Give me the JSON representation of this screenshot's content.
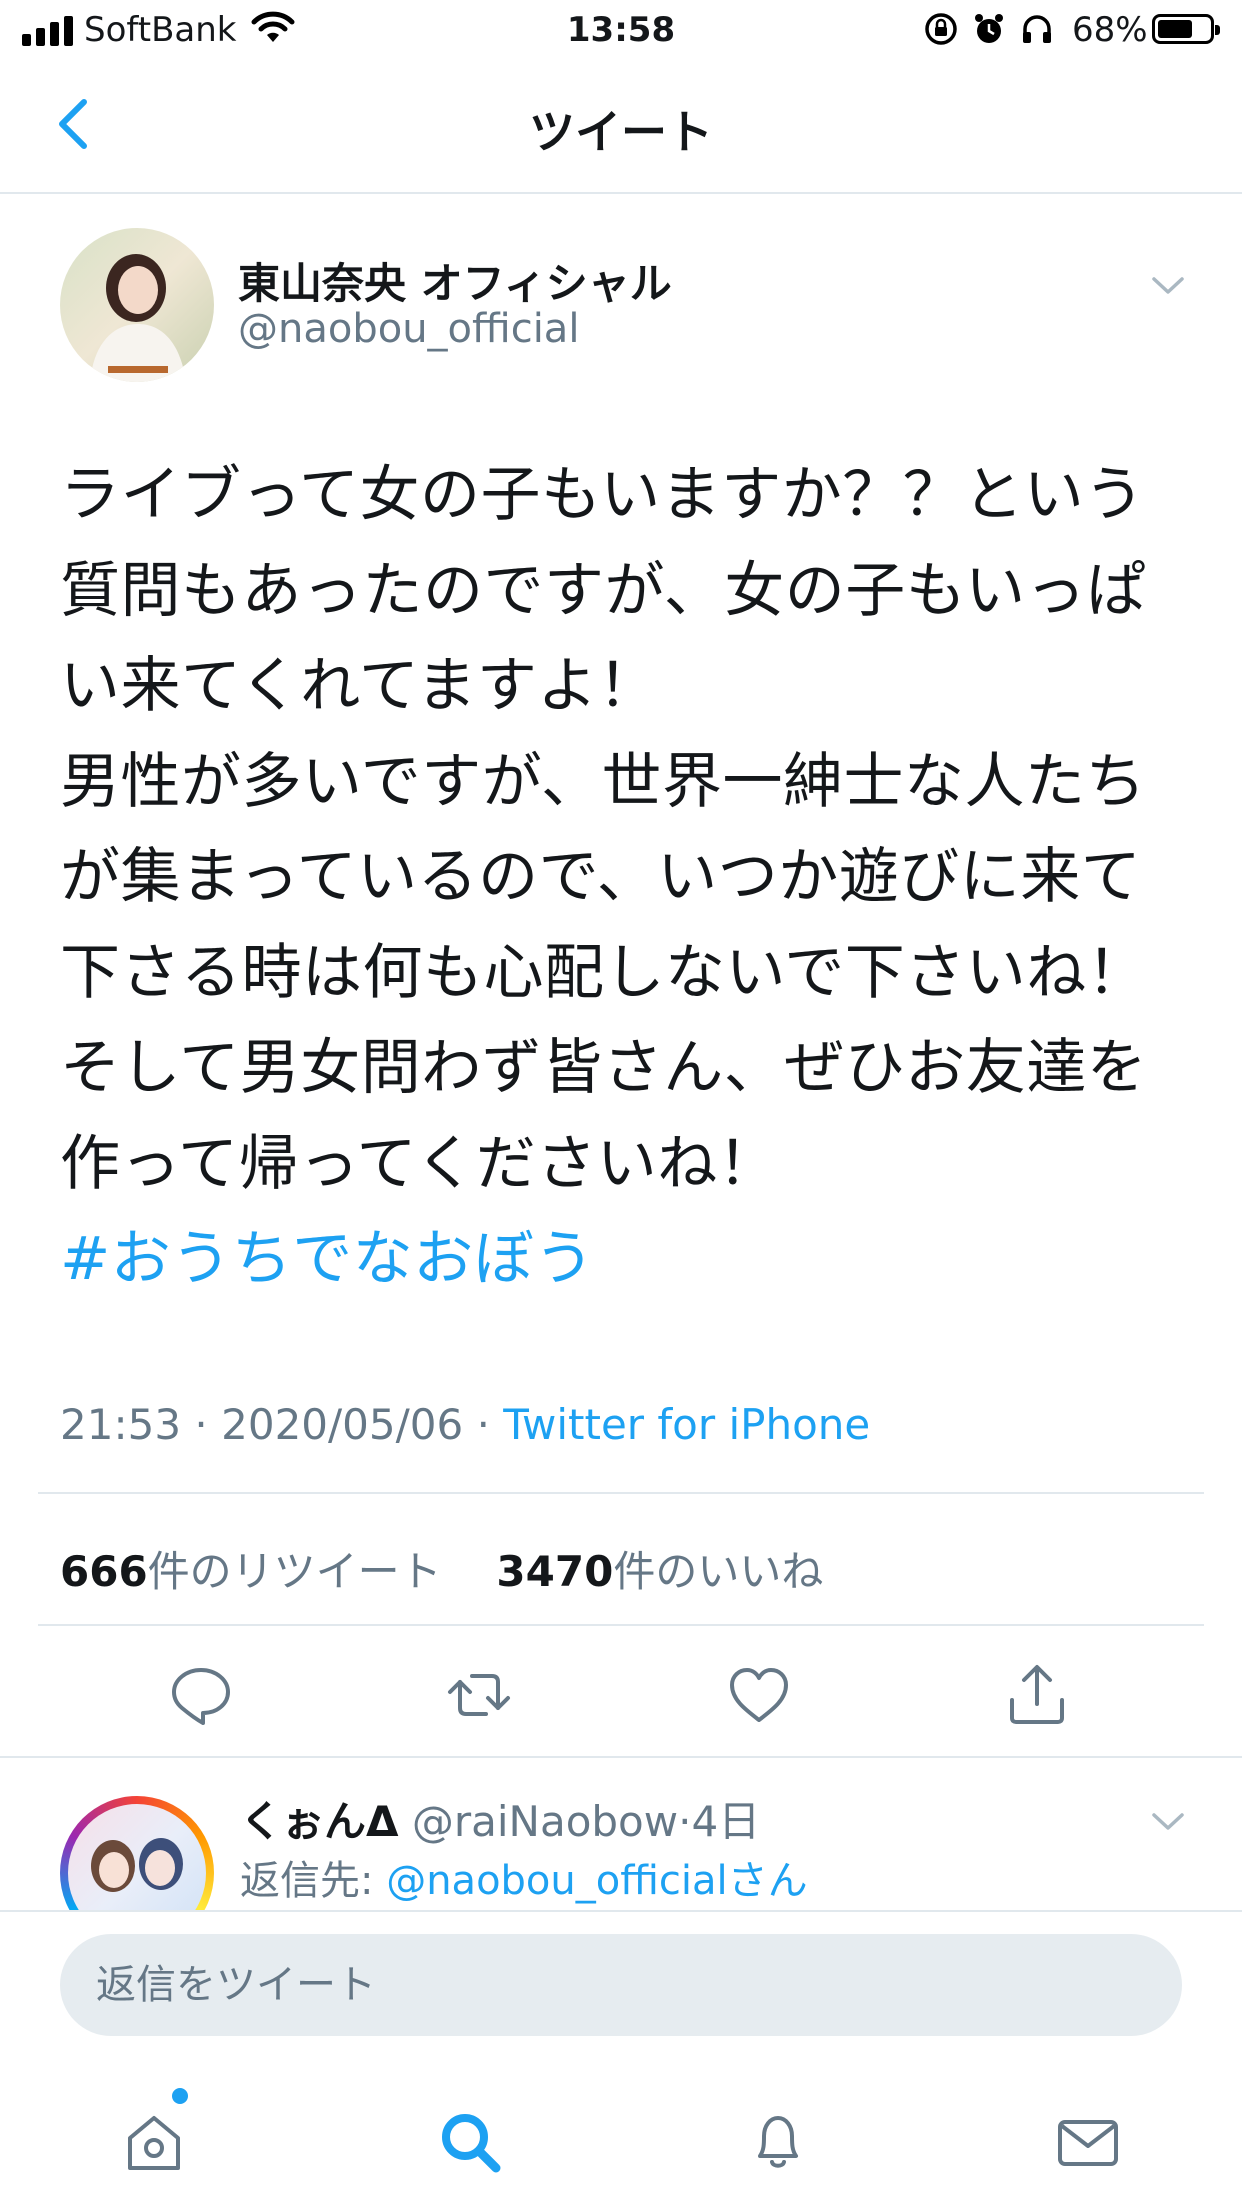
{
  "status_bar": {
    "carrier": "SoftBank",
    "time": "13:58",
    "battery": "68%",
    "battery_level": 0.68
  },
  "header": {
    "title": "ツイート"
  },
  "tweet": {
    "author_name": "東山奈央 オフィシャル",
    "author_handle": "@naobou_official",
    "text": "ライブって女の子もいますか？？という\n質問もあったのですが、女の子もいっぱ\nい来てくれてますよ！\n男性が多いですが、世界一紳士な人たち\nが集まっているので、いつか遊びに来て\n下さる時は何も心配しないで下さいね！\nそして男女問わず皆さん、ぜひお友達を\n作って帰ってくださいね！",
    "hashtag": "#おうちでなおぼう",
    "time": "21:53",
    "date": "2020/05/06",
    "separator": "·",
    "source": "Twitter for iPhone",
    "retweet_count": "666",
    "retweet_label": "件のリツイート",
    "like_count": "3470",
    "like_label": "件のいいね"
  },
  "reply": {
    "name": "くぉんΔ",
    "handle": "@raiNaobow",
    "separator": "·",
    "age": "4日",
    "reply_to_label": "返信先:",
    "reply_to_handle": "@naobou_official",
    "reply_to_suffix": "さん"
  },
  "composer": {
    "placeholder": "返信をツイート"
  },
  "colors": {
    "accent": "#1da1f2",
    "secondary_text": "#657786",
    "divider": "#e1e8ed",
    "input_bg": "#e6ecf0"
  },
  "icons": {
    "back": "chevron-left-icon",
    "caret": "chevron-down-icon",
    "reply": "comment-icon",
    "retweet": "retweet-icon",
    "like": "heart-icon",
    "share": "share-icon",
    "home": "home-icon",
    "search": "search-icon",
    "notifications": "bell-icon",
    "messages": "mail-icon"
  }
}
